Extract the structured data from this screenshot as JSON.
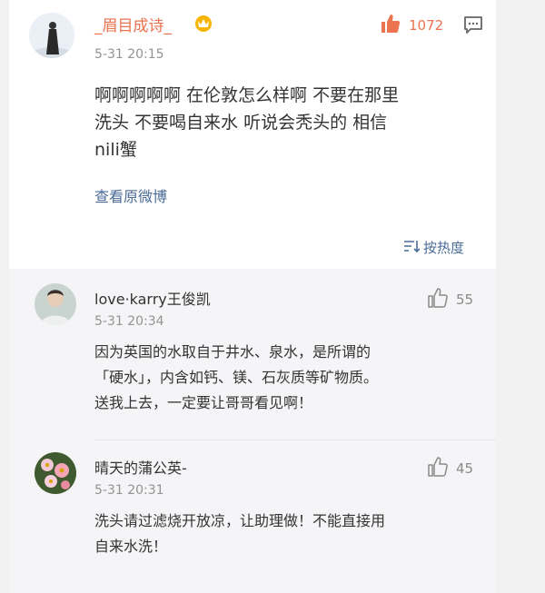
{
  "post": {
    "username": "_眉目成诗_",
    "timestamp": "5-31 20:15",
    "like_count": "1072",
    "text_lines": [
      "啊啊啊啊啊 在伦敦怎么样啊 不要在那里",
      "洗头 不要喝自来水 听说会秃头的 相信",
      "nili蟹"
    ],
    "view_original_label": "查看原微博",
    "sort_label": "按热度"
  },
  "comments": [
    {
      "username": "love·karry王俊凯",
      "timestamp": "5-31 20:34",
      "like_count": "55",
      "text_lines": [
        "因为英国的水取自于井水、泉水，是所谓的",
        "「硬水」，内含如钙、镁、石灰质等矿物质。",
        "送我上去，一定要让哥哥看见啊！"
      ]
    },
    {
      "username": "晴天的蒲公英-",
      "timestamp": "5-31 20:31",
      "like_count": "45",
      "text_lines": [
        "洗头请过滤烧开放凉，让助理做！不能直接用",
        "自来水洗！"
      ]
    }
  ],
  "colors": {
    "accent_orange": "#eb7350",
    "link_blue": "#4a6b99",
    "gray_text": "#939393"
  },
  "icons": [
    "crown-badge-icon",
    "thumbs-up-icon",
    "comment-icon",
    "sort-icon"
  ]
}
